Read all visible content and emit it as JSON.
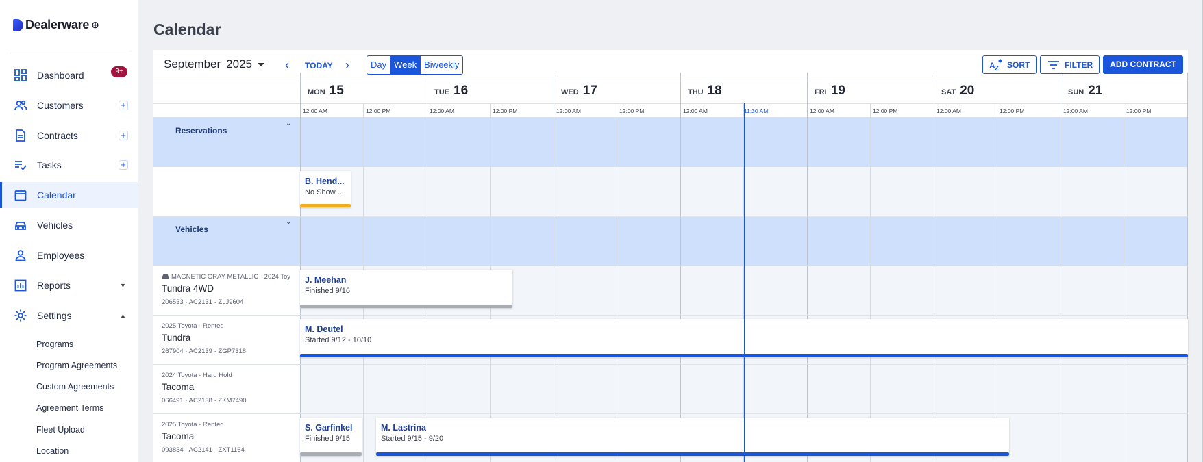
{
  "brand": {
    "name": "Dealerware",
    "suffix": "⊕"
  },
  "sidebar": {
    "items": [
      {
        "label": "Dashboard",
        "icon": "dashboard-icon",
        "badge": "9+"
      },
      {
        "label": "Customers",
        "icon": "customers-icon",
        "action": "+"
      },
      {
        "label": "Contracts",
        "icon": "contracts-icon",
        "action": "+"
      },
      {
        "label": "Tasks",
        "icon": "tasks-icon",
        "action": "+"
      },
      {
        "label": "Calendar",
        "icon": "calendar-icon",
        "active": true
      },
      {
        "label": "Vehicles",
        "icon": "car-icon"
      },
      {
        "label": "Employees",
        "icon": "employee-icon"
      },
      {
        "label": "Reports",
        "icon": "reports-icon",
        "caret": "▼"
      },
      {
        "label": "Settings",
        "icon": "gear-icon",
        "caret": "▲"
      }
    ],
    "settings_subitems": [
      "Programs",
      "Program Agreements",
      "Custom Agreements",
      "Agreement Terms",
      "Fleet Upload",
      "Location"
    ]
  },
  "page": {
    "title": "Calendar"
  },
  "toolbar": {
    "month": "September",
    "year": "2025",
    "prev": "‹",
    "next": "›",
    "today": "TODAY",
    "views": [
      "Day",
      "Week",
      "Biweekly"
    ],
    "selected_view": "Week",
    "sort": "SORT",
    "filter": "FILTER",
    "add_contract": "ADD CONTRACT"
  },
  "days": [
    {
      "dow": "MON",
      "num": "15"
    },
    {
      "dow": "TUE",
      "num": "16"
    },
    {
      "dow": "WED",
      "num": "17"
    },
    {
      "dow": "THU",
      "num": "18"
    },
    {
      "dow": "FRI",
      "num": "19"
    },
    {
      "dow": "SAT",
      "num": "20"
    },
    {
      "dow": "SUN",
      "num": "21"
    }
  ],
  "time_labels": {
    "am": "12:00 AM",
    "pm": "12:00 PM",
    "now": "11:30 AM"
  },
  "groups": {
    "reservations": {
      "label": "Reservations",
      "chevron": "⌄"
    },
    "vehicles": {
      "label": "Vehicles",
      "chevron": "⌄"
    }
  },
  "vehicles": [
    {
      "meta": "MAGNETIC GRAY METALLIC · 2024 Toy",
      "model": "Tundra 4WD",
      "ids": "206533 · AC2131 · ZLJ9604"
    },
    {
      "meta": "2025 Toyota · Rented",
      "model": "Tundra",
      "ids": "267904 · AC2139 · ZGP7318"
    },
    {
      "meta": "2024 Toyota · Hard Hold",
      "model": "Tacoma",
      "ids": "066491 · AC2138 · ZKM7490"
    },
    {
      "meta": "2025 Toyota · Rented",
      "model": "Tacoma",
      "ids": "093834 · AC2141 · ZXT1164"
    }
  ],
  "events": {
    "reservation": {
      "name": "B. Hend...",
      "sub": "No Show ...",
      "color": "#f0ad1e"
    },
    "v1": {
      "name": "J. Meehan",
      "sub": "Finished 9/16",
      "color": "#a9adb5"
    },
    "v2": {
      "name": "M. Deutel",
      "sub": "Started 9/12 - 10/10",
      "color": "#1a56db"
    },
    "v4a": {
      "name": "S. Garfinkel",
      "sub": "Finished 9/15",
      "color": "#a9adb5"
    },
    "v4b": {
      "name": "M. Lastrina",
      "sub": "Started 9/15 - 9/20",
      "color": "#1a56db"
    }
  },
  "colors": {
    "accent": "#1a56db",
    "group_bg": "#cfe0fc",
    "badge": "#a1143f"
  }
}
